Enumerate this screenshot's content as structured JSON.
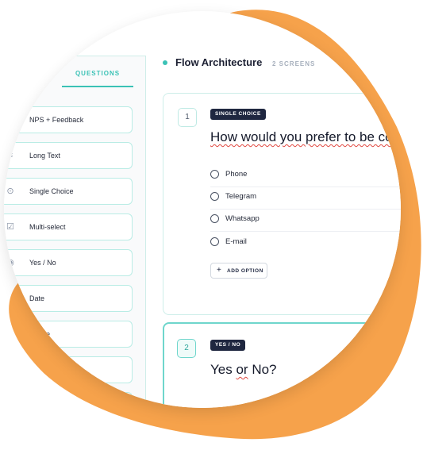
{
  "sidebar": {
    "tab_label": "QUESTIONS",
    "items": [
      {
        "label": "NPS + Feedback",
        "icon": "nps-icon"
      },
      {
        "label": "Long Text",
        "icon": "long-text-icon"
      },
      {
        "label": "Single Choice",
        "icon": "radio-icon"
      },
      {
        "label": "Multi-select",
        "icon": "checkbox-icon"
      },
      {
        "label": "Yes / No",
        "icon": "toggle-icon"
      },
      {
        "label": "Date",
        "icon": "calendar-icon"
      },
      {
        "label": "Phone",
        "icon": "phone-icon"
      },
      {
        "label": "",
        "icon": ""
      },
      {
        "label": "",
        "icon": ""
      }
    ]
  },
  "header": {
    "title": "Flow Architecture",
    "count": "2 SCREENS"
  },
  "questions": [
    {
      "number": "1",
      "type_badge": "SINGLE CHOICE",
      "title": "How would you prefer to be contacted?",
      "options": [
        "Phone",
        "Telegram",
        "Whatsapp",
        "E-mail"
      ],
      "add_option_label": "ADD OPTION"
    },
    {
      "number": "2",
      "type_badge": "YES / NO",
      "title_word1": "Yes",
      "title_word2": "or",
      "title_word3": "No?"
    }
  ],
  "colors": {
    "accent": "#3bc2b6",
    "blob": "#f6a24b",
    "badge": "#1f2740"
  }
}
